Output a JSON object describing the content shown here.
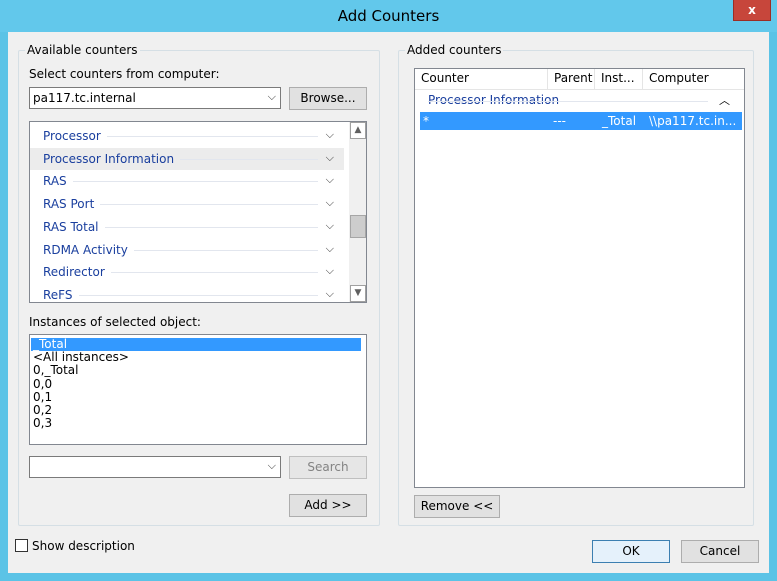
{
  "window": {
    "title": "Add Counters",
    "close": "x"
  },
  "available": {
    "legend": "Available counters",
    "computer_label": "Select counters from computer:",
    "computer_value": "pa117.tc.internal",
    "browse": "Browse...",
    "objects": [
      {
        "name": "Processor",
        "selected": false
      },
      {
        "name": "Processor Information",
        "selected": true
      },
      {
        "name": "RAS",
        "selected": false
      },
      {
        "name": "RAS Port",
        "selected": false
      },
      {
        "name": "RAS Total",
        "selected": false
      },
      {
        "name": "RDMA Activity",
        "selected": false
      },
      {
        "name": "Redirector",
        "selected": false
      },
      {
        "name": "ReFS",
        "selected": false
      }
    ],
    "instances_label": "Instances of selected object:",
    "instances": [
      "_Total",
      "<All instances>",
      "0,_Total",
      "0,0",
      "0,1",
      "0,2",
      "0,3"
    ],
    "search_value": "",
    "search": "Search",
    "add": "Add >>"
  },
  "added": {
    "legend": "Added counters",
    "columns": [
      "Counter",
      "Parent",
      "Inst...",
      "Computer"
    ],
    "group": "Processor Information",
    "row": {
      "counter": "*",
      "parent": "---",
      "instance": "_Total",
      "computer": "\\\\pa117.tc.in..."
    },
    "remove": "Remove <<"
  },
  "footer": {
    "show_description": "Show description",
    "ok": "OK",
    "cancel": "Cancel"
  },
  "colors": {
    "accent": "#3399ff",
    "titlebar": "#62c8eb",
    "link_text": "#1a3f9e",
    "close": "#c7463b"
  }
}
